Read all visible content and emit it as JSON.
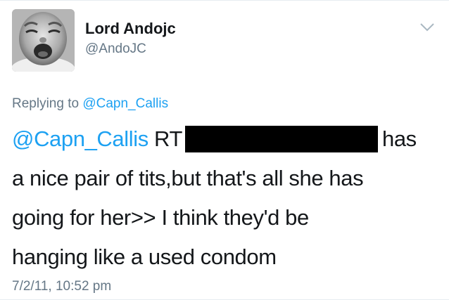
{
  "user": {
    "display_name": "Lord Andojc",
    "handle": "@AndoJC",
    "avatar_icon": "crying-baby-avatar-icon"
  },
  "reply": {
    "prefix": "Replying to",
    "mention": "@Capn_Callis"
  },
  "tweet": {
    "mention": "@Capn_Callis",
    "rt": "RT",
    "after_redaction": "has",
    "line2": "a nice pair of tits,but that's all she has",
    "line3": "going for her>> I think they'd be",
    "line4": "hanging like a used condom"
  },
  "timestamp": "7/2/11, 10:52 pm",
  "colors": {
    "link": "#1da1f2",
    "secondary": "#657786",
    "text": "#14171a"
  }
}
